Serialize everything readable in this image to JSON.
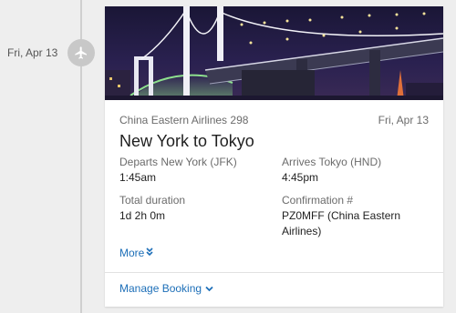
{
  "timeline": {
    "date": "Fri, Apr 13",
    "icon": "airplane-icon"
  },
  "card": {
    "airline": "China Eastern Airlines 298",
    "date": "Fri, Apr 13",
    "route": "New York to Tokyo",
    "departs_label": "Departs New York (JFK)",
    "departs_time": "1:45am",
    "arrives_label": "Arrives Tokyo (HND)",
    "arrives_time": "4:45pm",
    "duration_label": "Total duration",
    "duration_value": "1d 2h 0m",
    "confirmation_label": "Confirmation #",
    "confirmation_value": "PZ0MFF (China Eastern Airlines)",
    "more_label": "More",
    "manage_label": "Manage Booking"
  },
  "colors": {
    "link": "#1d6fb8",
    "timeline_badge": "#c8c8c8"
  }
}
